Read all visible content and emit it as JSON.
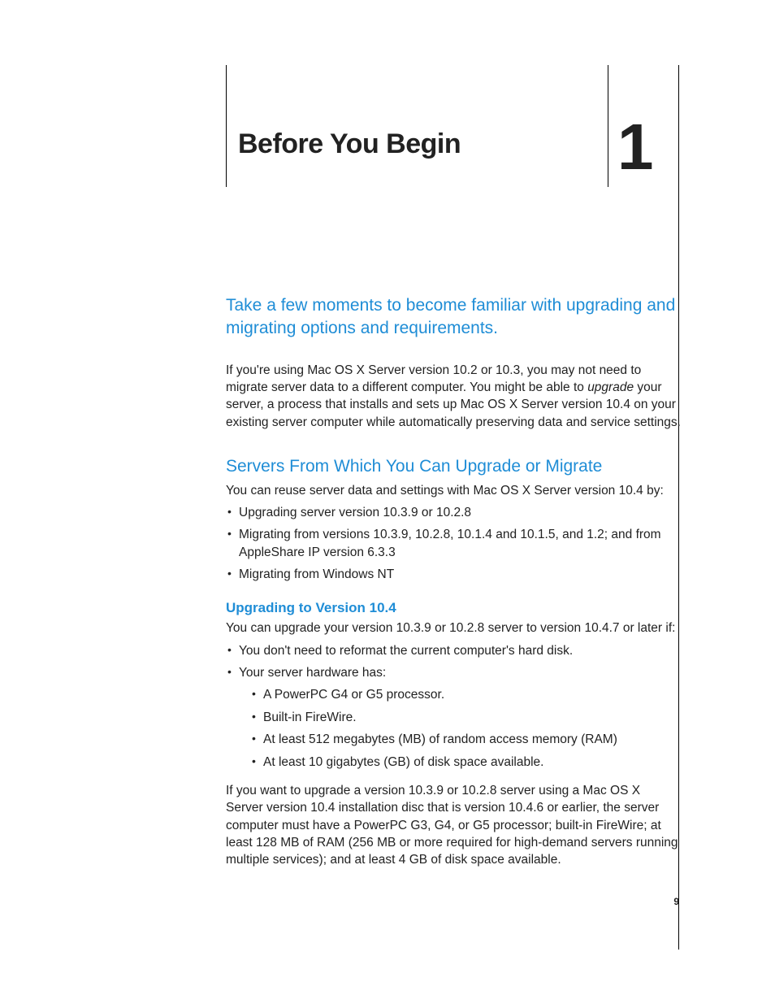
{
  "chapter": {
    "title": "Before You Begin",
    "number": "1"
  },
  "intro_callout": "Take a few moments to become familiar with upgrading and migrating options and requirements.",
  "intro_para_pre": "If you're using Mac OS X Server version 10.2 or 10.3, you may not need to migrate server data to a different computer. You might be able to ",
  "intro_para_em": "upgrade",
  "intro_para_post": " your server, a process that installs and sets up Mac OS X Server version 10.4 on your existing server computer while automatically preserving data and service settings.",
  "section1": {
    "heading": "Servers From Which You Can Upgrade or Migrate",
    "lead": "You can reuse server data and settings with Mac OS X Server version 10.4 by:",
    "bullets": [
      "Upgrading server version 10.3.9 or 10.2.8",
      "Migrating from versions 10.3.9, 10.2.8, 10.1.4 and 10.1.5, and 1.2; and from AppleShare IP version 6.3.3",
      "Migrating from Windows NT"
    ]
  },
  "section2": {
    "heading": "Upgrading to Version 10.4",
    "lead": "You can upgrade your version 10.3.9 or 10.2.8 server to version 10.4.7 or later if:",
    "bullets": [
      "You don't need to reformat the current computer's hard disk.",
      "Your server hardware has:"
    ],
    "nested": [
      "A PowerPC G4 or G5 processor.",
      "Built-in FireWire.",
      "At least 512 megabytes (MB) of random access memory (RAM)",
      "At least 10 gigabytes (GB) of disk space available."
    ],
    "tail": "If you want to upgrade a version 10.3.9 or 10.2.8 server using a Mac OS X Server version 10.4 installation disc that is version 10.4.6 or earlier, the server computer must have a PowerPC G3, G4, or G5 processor; built-in FireWire; at least 128 MB of RAM (256 MB or more required for high-demand servers running multiple services); and at least 4 GB of disk space available."
  },
  "page_number": "9"
}
